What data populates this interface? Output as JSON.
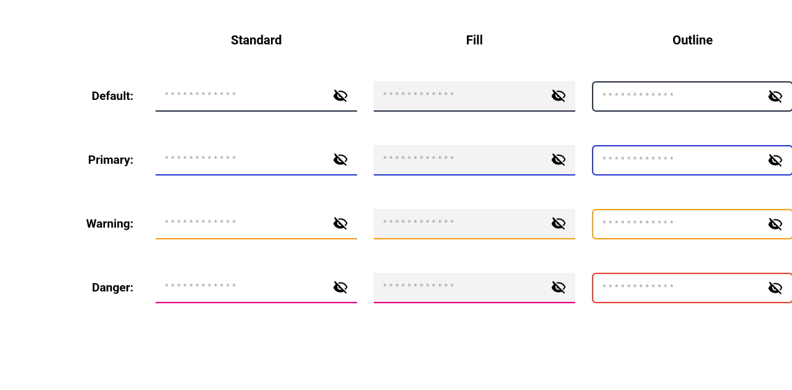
{
  "columns": {
    "standard": "Standard",
    "fill": "Fill",
    "outline": "Outline"
  },
  "rows": {
    "default": "Default:",
    "primary": "Primary:",
    "warning": "Warning:",
    "danger": "Danger:"
  },
  "placeholder": "************",
  "colors": {
    "default": "#3a4256",
    "primary": "#3a47d5",
    "warning": "#f5a623",
    "danger_line": "#e6007e",
    "danger_outline": "#e74c3c",
    "fill_bg": "#f3f3f3"
  },
  "icon": "eye-off-icon"
}
